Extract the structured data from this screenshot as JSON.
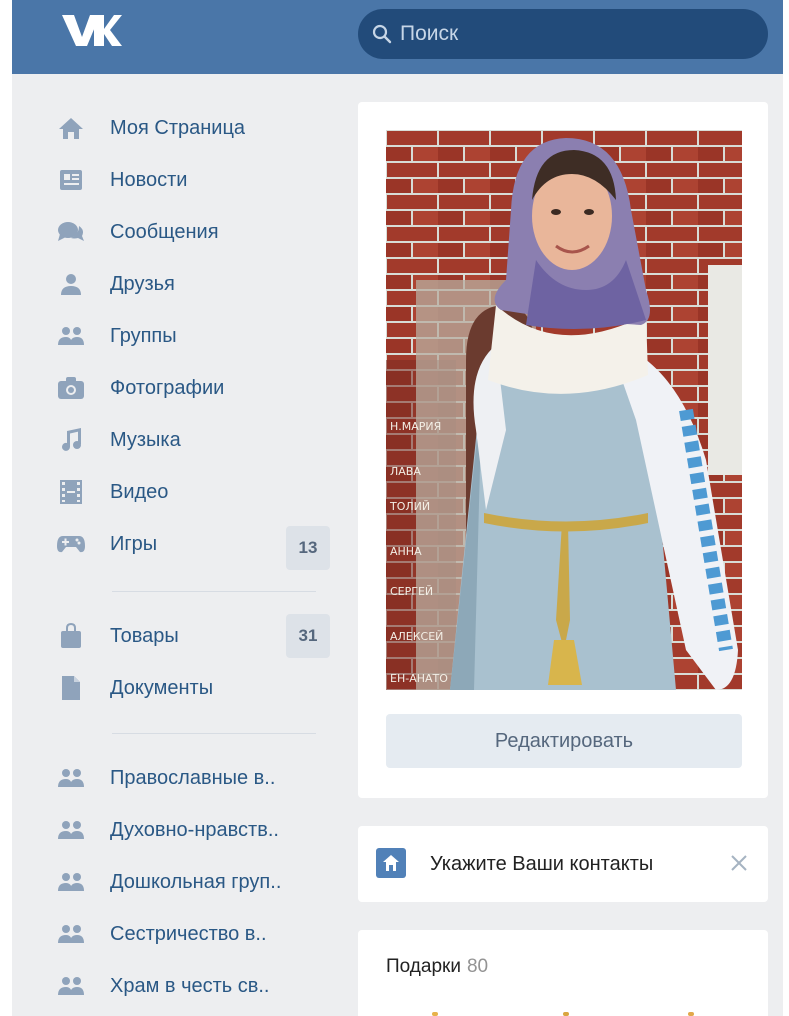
{
  "header": {
    "logo_name": "vk-logo",
    "search": {
      "placeholder": "Поиск"
    }
  },
  "sidebar": {
    "items": [
      {
        "label": "Моя Страница",
        "icon": "home-icon"
      },
      {
        "label": "Новости",
        "icon": "news-icon"
      },
      {
        "label": "Сообщения",
        "icon": "messages-icon"
      },
      {
        "label": "Друзья",
        "icon": "friend-icon"
      },
      {
        "label": "Группы",
        "icon": "groups-icon"
      },
      {
        "label": "Фотографии",
        "icon": "camera-icon"
      },
      {
        "label": "Музыка",
        "icon": "music-icon"
      },
      {
        "label": "Видео",
        "icon": "video-icon"
      },
      {
        "label": "Игры",
        "icon": "gamepad-icon",
        "counter": "13"
      },
      {
        "label": "Товары",
        "icon": "bag-icon",
        "counter": "31"
      },
      {
        "label": "Документы",
        "icon": "document-icon"
      }
    ],
    "groups": [
      {
        "label": "Православные в..",
        "icon": "group-icon"
      },
      {
        "label": "Духовно-нравств..",
        "icon": "group-icon"
      },
      {
        "label": "Дошкольная груп..",
        "icon": "group-icon"
      },
      {
        "label": "Сестричество в..",
        "icon": "group-icon"
      },
      {
        "label": "Храм в честь св..",
        "icon": "group-icon"
      }
    ]
  },
  "profile": {
    "edit_label": "Редактировать",
    "contacts_label": "Укажите Ваши контакты",
    "gifts_label": "Подарки",
    "gifts_count": "80"
  },
  "colors": {
    "header": "#4a76a8",
    "search": "#224b7a",
    "background": "#edeef0",
    "link": "#2a5885",
    "icon": "#8fa3bb"
  }
}
